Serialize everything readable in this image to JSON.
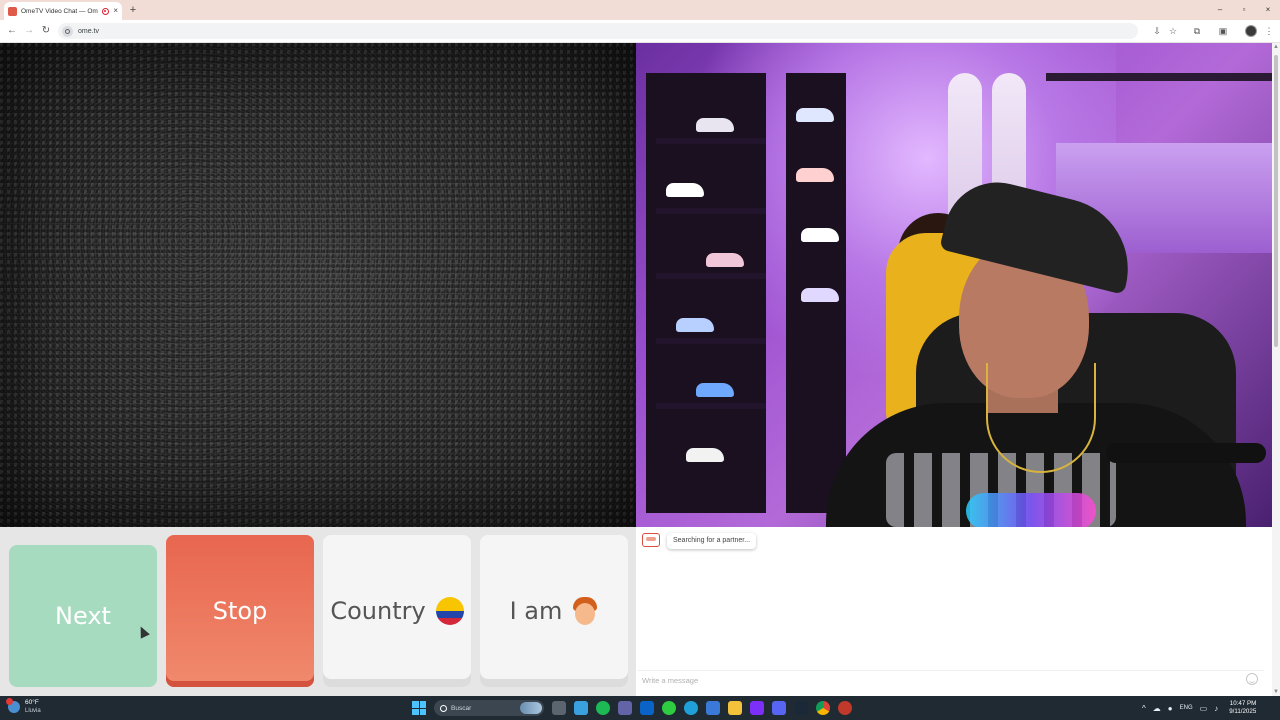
{
  "browser": {
    "tab_title": "OmeTV Video Chat — Ome",
    "tab_close": "×",
    "new_tab": "+",
    "url": "ome.tv",
    "nav": {
      "back": "←",
      "forward": "→",
      "reload": "↻"
    },
    "window_controls": {
      "minimize": "–",
      "maximize": "▫",
      "close": "×"
    },
    "toolbar_icons": {
      "install": "⇩",
      "bookmark": "☆",
      "extensions": "⧉",
      "sidepanel": "▣",
      "menu": "⋮"
    }
  },
  "controls": {
    "next_label": "Next",
    "stop_label": "Stop",
    "country_label": "Country",
    "country_flag": "colombia-flag",
    "iam_label": "I am",
    "iam_icon": "boy-emoji"
  },
  "chat": {
    "status_message": "Searching for a partner...",
    "input_placeholder": "Write a message"
  },
  "taskbar": {
    "weather_temp": "60°F",
    "weather_desc": "Lluvia",
    "search_label": "Buscar",
    "language": "ENG",
    "time": "10:47 PM",
    "date": "9/11/2025"
  },
  "colors": {
    "next_button": "#a6dbc0",
    "stop_button": "#e8664f",
    "neutral_button": "#f5f5f5"
  }
}
